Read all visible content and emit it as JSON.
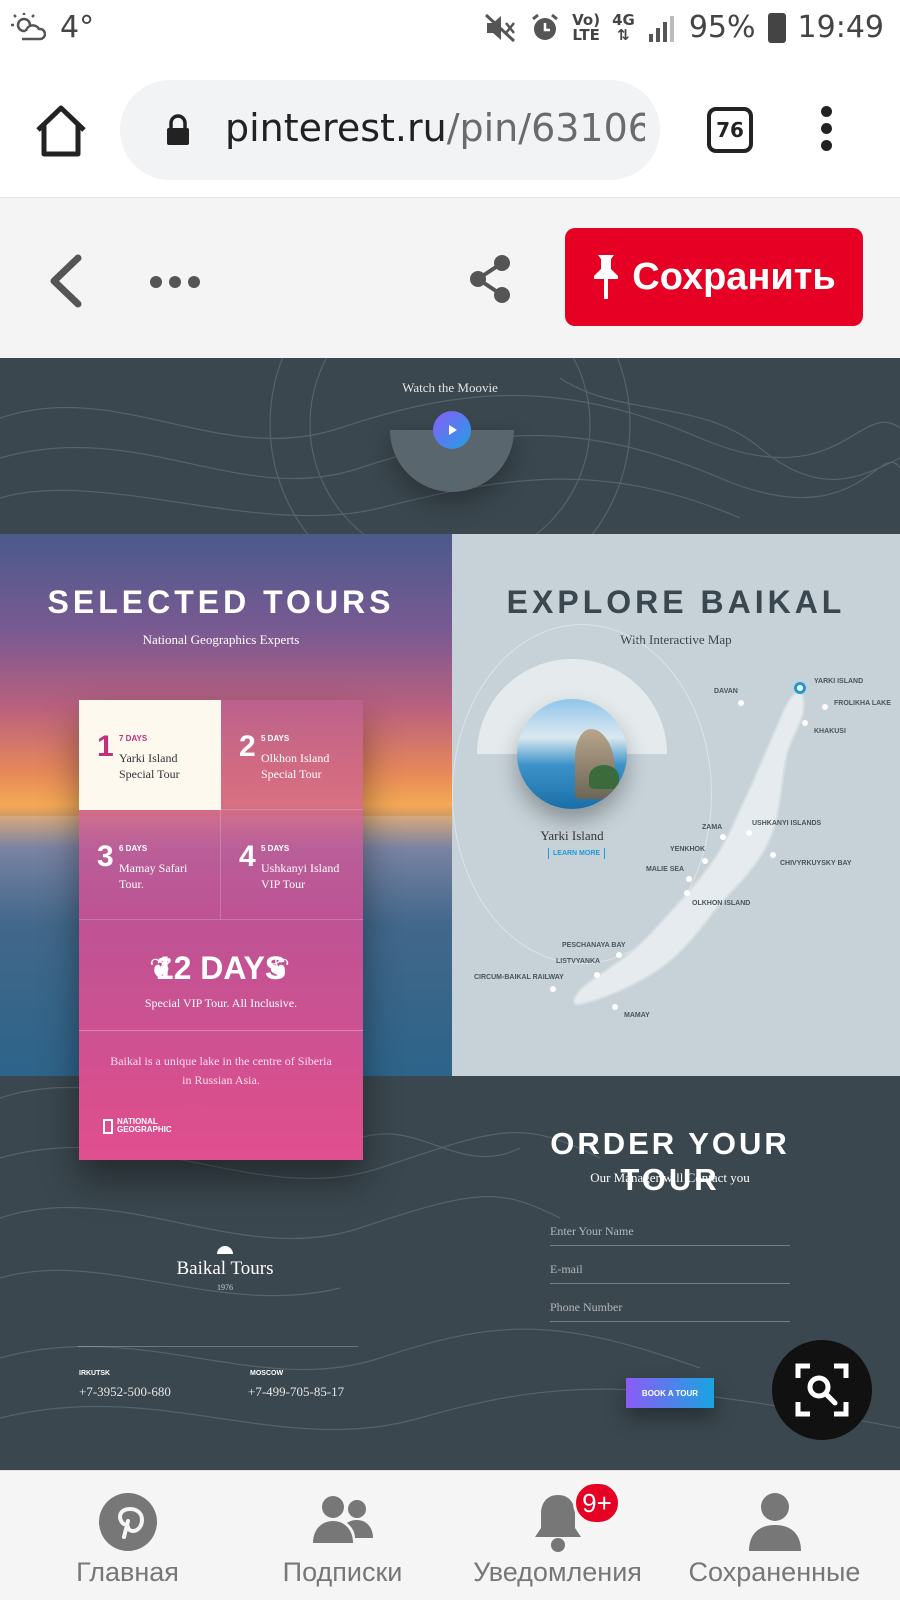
{
  "status_bar": {
    "temperature": "4°",
    "network_label": "Vo)",
    "lte_label": "LTE",
    "gen_label": "4G",
    "battery": "95%",
    "time": "19:49"
  },
  "browser": {
    "url_host": "pinterest.ru",
    "url_path": "/pin/63106",
    "tab_count": "76"
  },
  "pin_toolbar": {
    "save_label": "Сохранить"
  },
  "pin_image": {
    "movie_label": "Watch the Moovie",
    "selected_tours": {
      "title": "SELECTED TOURS",
      "subtitle": "National Geographics Experts",
      "tours": [
        {
          "num": "1",
          "days": "7 DAYS",
          "name": "Yarki Island Special Tour"
        },
        {
          "num": "2",
          "days": "5 DAYS",
          "name": "Olkhon Island Special Tour"
        },
        {
          "num": "3",
          "days": "6 DAYS",
          "name": "Mamay Safari Tour."
        },
        {
          "num": "4",
          "days": "5 DAYS",
          "name": "Ushkanyi Island VIP Tour"
        }
      ],
      "days_big": "12 DAYS",
      "days_sub": "Special VIP Tour. All Inclusive.",
      "description": "Baikal is a unique lake in the centre of Siberia in Russian Asia.",
      "natgeo": "NATIONAL GEOGRAPHIC"
    },
    "explore": {
      "title": "EXPLORE BAIKAL",
      "subtitle": "With Interactive Map",
      "island_name": "Yarki Island",
      "learn_more": "LEARN MORE",
      "map_labels": {
        "yarki": "YARKI ISLAND",
        "frolikha": "FROLIKHA LAKE",
        "khakusi": "KHAKUSI",
        "davan": "DAVAN",
        "zama": "ZAMA",
        "ushkanyi": "USHKANYI ISLANDS",
        "yenkhok": "YENKHOK",
        "chivyrkuysky": "CHIVYRKUYSKY BAY",
        "malie_sea": "MALIE SEA",
        "olkhon": "OLKHON ISLAND",
        "peschanaya": "PESCHANAYA BAY",
        "listvyanka": "LISTVYANKA",
        "circum": "CIRCUM-BAIKAL RAILWAY",
        "mamay": "MAMAY"
      }
    },
    "order": {
      "title": "ORDER YOUR TOUR",
      "subtitle": "Our Manager will Contact you",
      "name_placeholder": "Enter Your Name",
      "email_placeholder": "E-mail",
      "phone_placeholder": "Phone Number",
      "button": "BOOK A TOUR"
    },
    "footer": {
      "logo_name": "Baikal Tours",
      "logo_year": "1976",
      "city1": "IRKUTSK",
      "phone1": "+7-3952-500-680",
      "city2": "MOSCOW",
      "phone2": "+7-499-705-85-17"
    }
  },
  "bottom_nav": {
    "items": [
      {
        "label": "Главная"
      },
      {
        "label": "Подписки"
      },
      {
        "label": "Уведомления",
        "badge": "9+"
      },
      {
        "label": "Сохраненные"
      }
    ]
  },
  "colors": {
    "pinterest_red": "#e60023",
    "page_dark": "#3a474e",
    "map_bg": "#c6d2d8",
    "accent_pink": "#e14f8f"
  }
}
